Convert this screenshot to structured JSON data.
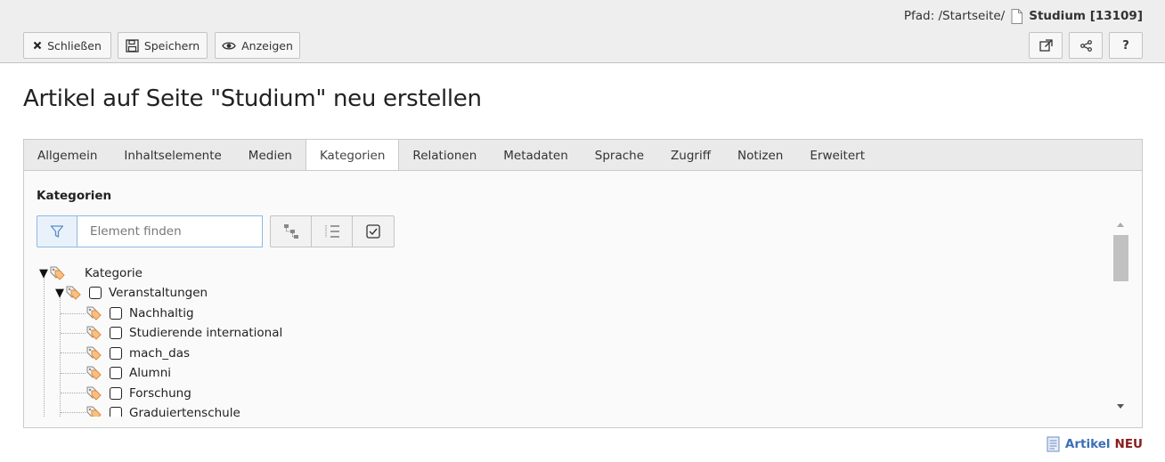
{
  "header": {
    "path_label": "Pfad: /Startseite/",
    "page_title": "Studium [13109]",
    "buttons": {
      "close": "Schließen",
      "save": "Speichern",
      "view": "Anzeigen",
      "help": "?"
    },
    "icons": {
      "close": "x-icon",
      "save": "floppy-disk-icon",
      "view": "eye-icon",
      "open_new_window": "external-link-icon",
      "share": "share-icon"
    }
  },
  "heading": "Artikel auf Seite \"Studium\" neu erstellen",
  "tabs": [
    {
      "label": "Allgemein",
      "active": false
    },
    {
      "label": "Inhaltselemente",
      "active": false
    },
    {
      "label": "Medien",
      "active": false
    },
    {
      "label": "Kategorien",
      "active": true
    },
    {
      "label": "Relationen",
      "active": false
    },
    {
      "label": "Metadaten",
      "active": false
    },
    {
      "label": "Sprache",
      "active": false
    },
    {
      "label": "Zugriff",
      "active": false
    },
    {
      "label": "Notizen",
      "active": false
    },
    {
      "label": "Erweitert",
      "active": false
    }
  ],
  "categories": {
    "title": "Kategorien",
    "filter_placeholder": "Element finden",
    "toolbar": [
      "tree-structure-icon",
      "list-icon",
      "checkbox-checked-icon"
    ],
    "tree": {
      "root": "Kategorie",
      "group": "Veranstaltungen",
      "items": [
        "Nachhaltig",
        "Studierende international",
        "mach_das",
        "Alumni",
        "Forschung",
        "Graduiertenschule"
      ]
    }
  },
  "footer": {
    "record_type": "Artikel",
    "status": "NEU"
  },
  "colors": {
    "accent_blue": "#3b6fb6",
    "status_red": "#8a1c1c",
    "tag_orange": "#e8892d"
  }
}
